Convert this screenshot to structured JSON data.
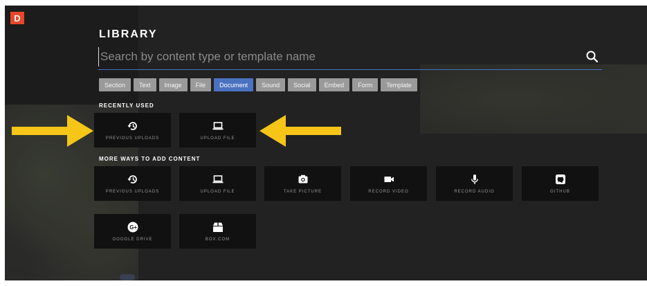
{
  "logo": {
    "letter": "D",
    "color": "#e8472b"
  },
  "library": {
    "title": "LIBRARY",
    "search": {
      "placeholder": "Search by content type or template name",
      "value": ""
    },
    "tabs": [
      {
        "label": "Section",
        "active": false
      },
      {
        "label": "Text",
        "active": false
      },
      {
        "label": "Image",
        "active": false
      },
      {
        "label": "File",
        "active": false
      },
      {
        "label": "Document",
        "active": true
      },
      {
        "label": "Sound",
        "active": false
      },
      {
        "label": "Social",
        "active": false
      },
      {
        "label": "Embed",
        "active": false
      },
      {
        "label": "Form",
        "active": false
      },
      {
        "label": "Template",
        "active": false
      }
    ],
    "recently_used": {
      "label": "RECENTLY USED",
      "items": [
        {
          "label": "PREVIOUS UPLOADS",
          "icon": "history-icon"
        },
        {
          "label": "UPLOAD FILE",
          "icon": "laptop-icon"
        }
      ]
    },
    "more_ways": {
      "label": "MORE WAYS TO ADD CONTENT",
      "items": [
        {
          "label": "PREVIOUS UPLOADS",
          "icon": "history-icon"
        },
        {
          "label": "UPLOAD FILE",
          "icon": "laptop-icon"
        },
        {
          "label": "TAKE PICTURE",
          "icon": "camera-icon"
        },
        {
          "label": "RECORD VIDEO",
          "icon": "video-camera-icon"
        },
        {
          "label": "RECORD AUDIO",
          "icon": "microphone-icon"
        },
        {
          "label": "GITHUB",
          "icon": "github-icon"
        },
        {
          "label": "GOOGLE DRIVE",
          "icon": "google-plus-icon"
        },
        {
          "label": "BOX.COM",
          "icon": "box-icon"
        }
      ]
    }
  },
  "annotation_arrow_color": "#f5c518",
  "accent_color": "#4a72c0"
}
